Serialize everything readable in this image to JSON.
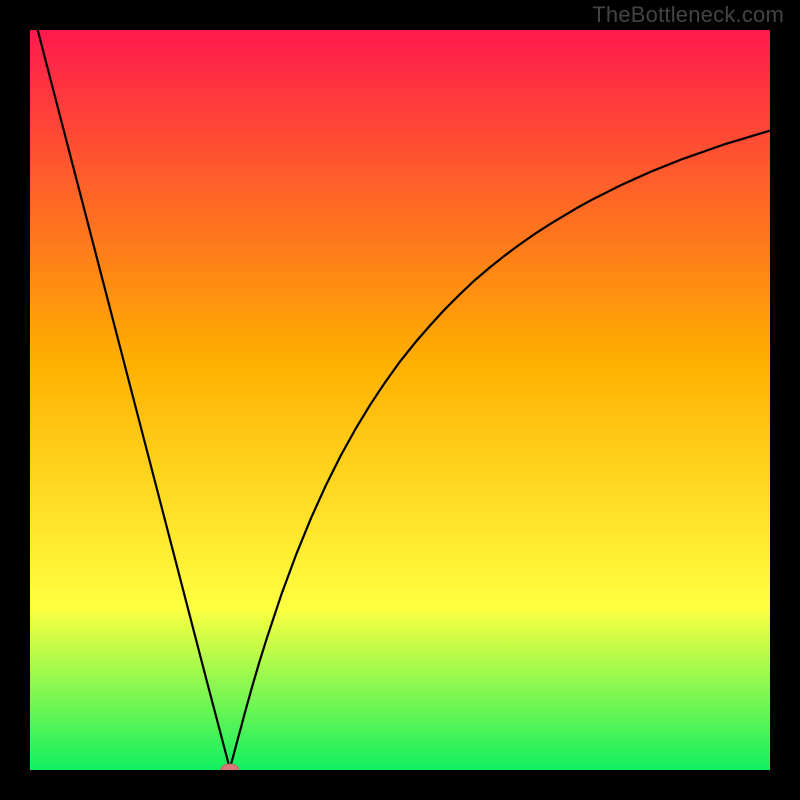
{
  "watermark": "TheBottleneck.com",
  "colors": {
    "frame": "#000000",
    "gradient_top": "#ff1a4d",
    "gradient_mid": "#ffb000",
    "gradient_low": "#ffff40",
    "gradient_bottom": "#10f060",
    "curve": "#000000",
    "marker_fill": "#d97a7a",
    "marker_stroke": "#c86060"
  },
  "chart_data": {
    "type": "line",
    "title": "",
    "xlabel": "",
    "ylabel": "",
    "xlim": [
      0,
      100
    ],
    "ylim": [
      0,
      100
    ],
    "notch_x": 27,
    "marker": {
      "x": 27,
      "y": 0
    },
    "series": [
      {
        "name": "curve",
        "x": [
          0,
          2,
          4,
          6,
          8,
          10,
          12,
          14,
          16,
          18,
          20,
          22,
          24,
          25,
          26,
          26.5,
          27,
          27.5,
          28,
          28.5,
          29,
          30,
          31,
          32,
          34,
          36,
          38,
          40,
          42,
          44,
          46,
          48,
          50,
          52,
          54,
          56,
          58,
          60,
          62,
          64,
          66,
          68,
          70,
          72,
          74,
          76,
          78,
          80,
          82,
          84,
          86,
          88,
          90,
          92,
          94,
          96,
          98,
          100
        ],
        "y": [
          104,
          96.3,
          88.6,
          80.9,
          73.2,
          65.5,
          57.8,
          50.1,
          42.4,
          34.7,
          27.0,
          19.3,
          11.6,
          7.8,
          4.0,
          2.1,
          0.2,
          2.0,
          3.9,
          5.7,
          7.6,
          11.2,
          14.6,
          17.8,
          23.8,
          29.2,
          34.1,
          38.5,
          42.5,
          46.1,
          49.4,
          52.4,
          55.2,
          57.7,
          60.0,
          62.2,
          64.2,
          66.1,
          67.8,
          69.4,
          70.9,
          72.3,
          73.6,
          74.8,
          76.0,
          77.1,
          78.1,
          79.1,
          80.0,
          80.9,
          81.7,
          82.5,
          83.2,
          83.9,
          84.6,
          85.2,
          85.8,
          86.4
        ]
      }
    ]
  }
}
